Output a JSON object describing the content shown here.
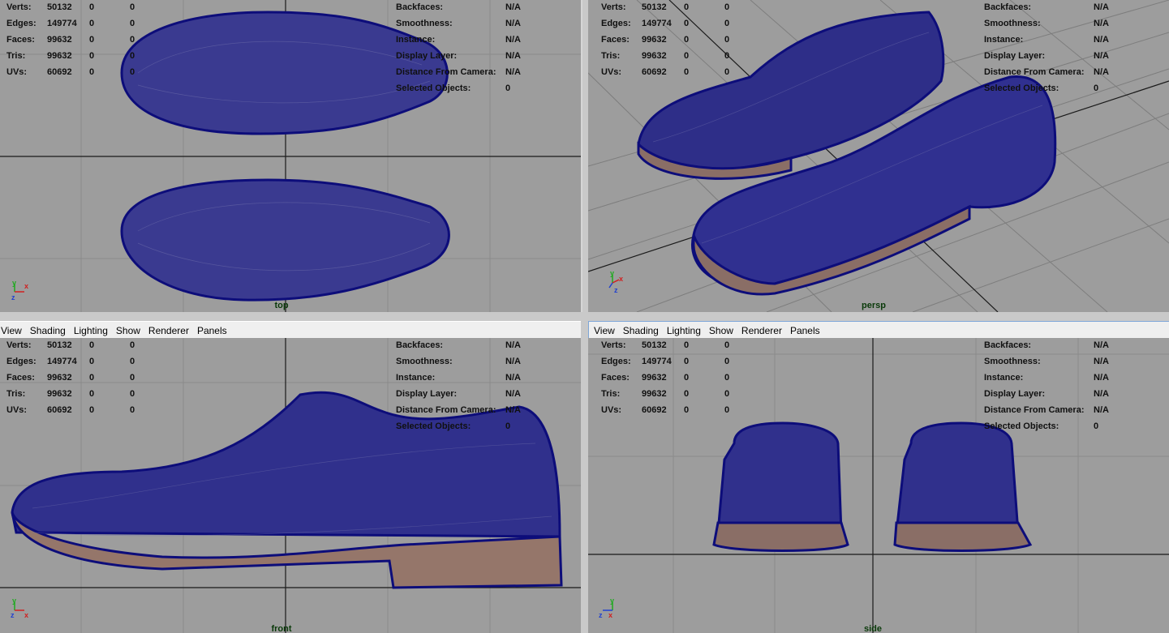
{
  "menubar": [
    "View",
    "Shading",
    "Lighting",
    "Show",
    "Renderer",
    "Panels"
  ],
  "hud_left": [
    {
      "label": "Verts:",
      "v1": "50132",
      "v2": "0",
      "v3": "0"
    },
    {
      "label": "Edges:",
      "v1": "149774",
      "v2": "0",
      "v3": "0"
    },
    {
      "label": "Faces:",
      "v1": "99632",
      "v2": "0",
      "v3": "0"
    },
    {
      "label": "Tris:",
      "v1": "99632",
      "v2": "0",
      "v3": "0"
    },
    {
      "label": "UVs:",
      "v1": "60692",
      "v2": "0",
      "v3": "0"
    }
  ],
  "hud_right": [
    {
      "label": "Backfaces:",
      "value": "N/A"
    },
    {
      "label": "Smoothness:",
      "value": "N/A"
    },
    {
      "label": "Instance:",
      "value": "N/A"
    },
    {
      "label": "Display Layer:",
      "value": "N/A"
    },
    {
      "label": "Distance From Camera:",
      "value": "N/A"
    },
    {
      "label": "Selected Objects:",
      "value": "0"
    }
  ],
  "views": {
    "top": "top",
    "persp": "persp",
    "front": "front",
    "side": "side"
  },
  "axes": {
    "top": [
      "y",
      "x",
      "z"
    ],
    "persp": [
      "y",
      "x",
      "z"
    ],
    "front": [
      "y",
      "z",
      "x"
    ],
    "side": [
      "y",
      "z",
      "x"
    ]
  },
  "colors": {
    "viewport_bg": "#9d9d9d",
    "grid": "#8a8a8a",
    "axis_line": "#1a1a1a",
    "mesh_wire": "#0d0d7a",
    "mesh_fill": "#2a2a8c",
    "sole_fill": "#9a7a6a",
    "panel_menubar": "#efefef",
    "active_panel_border": "#7ea6d8"
  }
}
